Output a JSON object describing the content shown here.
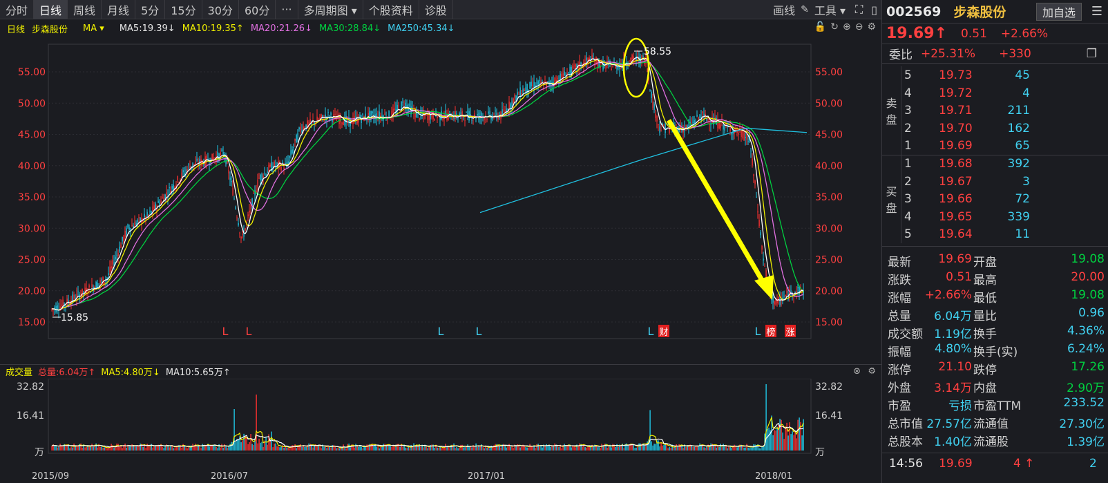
{
  "toolbar": {
    "tabs": [
      "分时",
      "日线",
      "周线",
      "月线",
      "5分",
      "15分",
      "30分",
      "60分",
      "···",
      "多周期图 ▾",
      "个股资料",
      "诊股"
    ],
    "active": "日线",
    "draw": "画线",
    "tools": "工具 ▾"
  },
  "ma_row": {
    "period": "日线",
    "name": "步森股份",
    "indicator": "MA ▾",
    "ma5": "MA5:19.39↓",
    "ma10": "MA10:19.35↑",
    "ma20": "MA20:21.26↓",
    "ma30": "MA30:28.84↓",
    "ma250": "MA250:45.34↓"
  },
  "chart": {
    "y_labels": [
      "55.00",
      "50.00",
      "45.00",
      "40.00",
      "35.00",
      "30.00",
      "25.00",
      "20.00",
      "15.00"
    ],
    "high_label": "58.55",
    "low_label": "15.85",
    "markers": [
      "L",
      "L",
      "L",
      "L",
      "L",
      "财",
      "L",
      "榜",
      "涨"
    ]
  },
  "volume": {
    "title": "成交量",
    "total": "总量:6.04万↑",
    "ma5": "MA5:4.80万↓",
    "ma10": "MA10:5.65万↑",
    "y_labels": [
      "32.82",
      "16.41",
      "万"
    ]
  },
  "dates": [
    "2015/09",
    "2016/07",
    "2017/01",
    "2018/01"
  ],
  "stock": {
    "code": "002569",
    "name": "步森股份",
    "add_fav": "加自选",
    "price": "19.69↑",
    "change": "0.51",
    "change_pct": "+2.66%",
    "weibi_label": "委比",
    "weibi_pct": "+25.31%",
    "weicha": "+330"
  },
  "orderbook": {
    "sell_label": [
      "卖",
      "盘"
    ],
    "buy_label": [
      "买",
      "盘"
    ],
    "sell": [
      {
        "level": "5",
        "price": "19.73",
        "vol": "45"
      },
      {
        "level": "4",
        "price": "19.72",
        "vol": "4"
      },
      {
        "level": "3",
        "price": "19.71",
        "vol": "211"
      },
      {
        "level": "2",
        "price": "19.70",
        "vol": "162"
      },
      {
        "level": "1",
        "price": "19.69",
        "vol": "65"
      }
    ],
    "buy": [
      {
        "level": "1",
        "price": "19.68",
        "vol": "392"
      },
      {
        "level": "2",
        "price": "19.67",
        "vol": "3"
      },
      {
        "level": "3",
        "price": "19.66",
        "vol": "72"
      },
      {
        "level": "4",
        "price": "19.65",
        "vol": "339"
      },
      {
        "level": "5",
        "price": "19.64",
        "vol": "11"
      }
    ]
  },
  "stats": [
    {
      "l1": "最新",
      "v1": "19.69",
      "c1": "red",
      "l2": "开盘",
      "v2": "19.08",
      "c2": "green"
    },
    {
      "l1": "涨跌",
      "v1": "0.51",
      "c1": "red",
      "l2": "最高",
      "v2": "20.00",
      "c2": "red"
    },
    {
      "l1": "涨幅",
      "v1": "+2.66%",
      "c1": "red",
      "l2": "最低",
      "v2": "19.08",
      "c2": "green"
    },
    {
      "l1": "总量",
      "v1": "6.04万",
      "c1": "cyan",
      "l2": "量比",
      "v2": "0.96",
      "c2": "cyan"
    },
    {
      "l1": "成交额",
      "v1": "1.19亿",
      "c1": "cyan",
      "l2": "换手",
      "v2": "4.36%",
      "c2": "cyan"
    },
    {
      "l1": "振幅",
      "v1": "4.80%",
      "c1": "cyan",
      "l2": "换手(实)",
      "v2": "6.24%",
      "c2": "cyan"
    },
    {
      "l1": "涨停",
      "v1": "21.10",
      "c1": "red",
      "l2": "跌停",
      "v2": "17.26",
      "c2": "green"
    },
    {
      "l1": "外盘",
      "v1": "3.14万",
      "c1": "red",
      "l2": "内盘",
      "v2": "2.90万",
      "c2": "green"
    },
    {
      "l1": "市盈",
      "v1": "亏损",
      "c1": "cyan",
      "l2": "市盈TTM",
      "v2": "233.52",
      "c2": "cyan"
    },
    {
      "l1": "总市值",
      "v1": "27.57亿",
      "c1": "cyan",
      "l2": "流通值",
      "v2": "27.30亿",
      "c2": "cyan"
    },
    {
      "l1": "总股本",
      "v1": "1.40亿",
      "c1": "cyan",
      "l2": "流通股",
      "v2": "1.39亿",
      "c2": "cyan"
    }
  ],
  "tick": {
    "time": "14:56",
    "price": "19.69",
    "vol": "4",
    "dir": "↑",
    "count": "2"
  },
  "colors": {
    "up": "#ff4040",
    "down": "#00d0f0",
    "ma5": "#ffffff",
    "ma10": "#f0f000",
    "ma20": "#e070e0",
    "ma30": "#00d040",
    "ma250": "#20c0e0",
    "annotation": "#ffff00"
  }
}
